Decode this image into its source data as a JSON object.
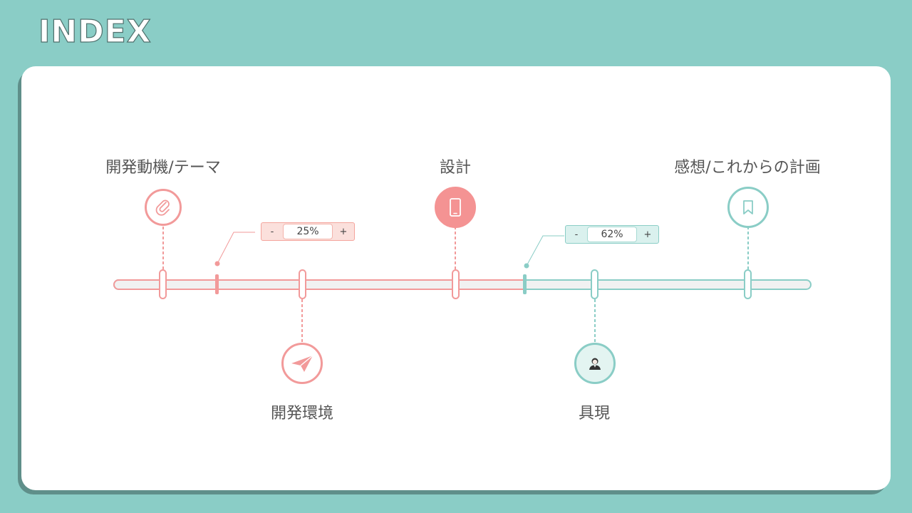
{
  "header": {
    "title": "INDEX"
  },
  "colors": {
    "background": "#8acdc6",
    "pink": "#f29a9a",
    "teal": "#8acdc6",
    "card": "#ffffff"
  },
  "timeline": {
    "items": [
      {
        "label": "開発動機/テーマ",
        "icon": "paperclip-icon"
      },
      {
        "label": "開発環境",
        "icon": "paper-plane-icon"
      },
      {
        "label": "設計",
        "icon": "smartphone-icon"
      },
      {
        "label": "具現",
        "icon": "person-icon"
      },
      {
        "label": "感想/これからの計画",
        "icon": "bookmark-icon"
      }
    ],
    "progress_overall": 0.59
  },
  "steppers": [
    {
      "minus": "-",
      "value": "25%",
      "plus": "+"
    },
    {
      "minus": "-",
      "value": "62%",
      "plus": "+"
    }
  ]
}
